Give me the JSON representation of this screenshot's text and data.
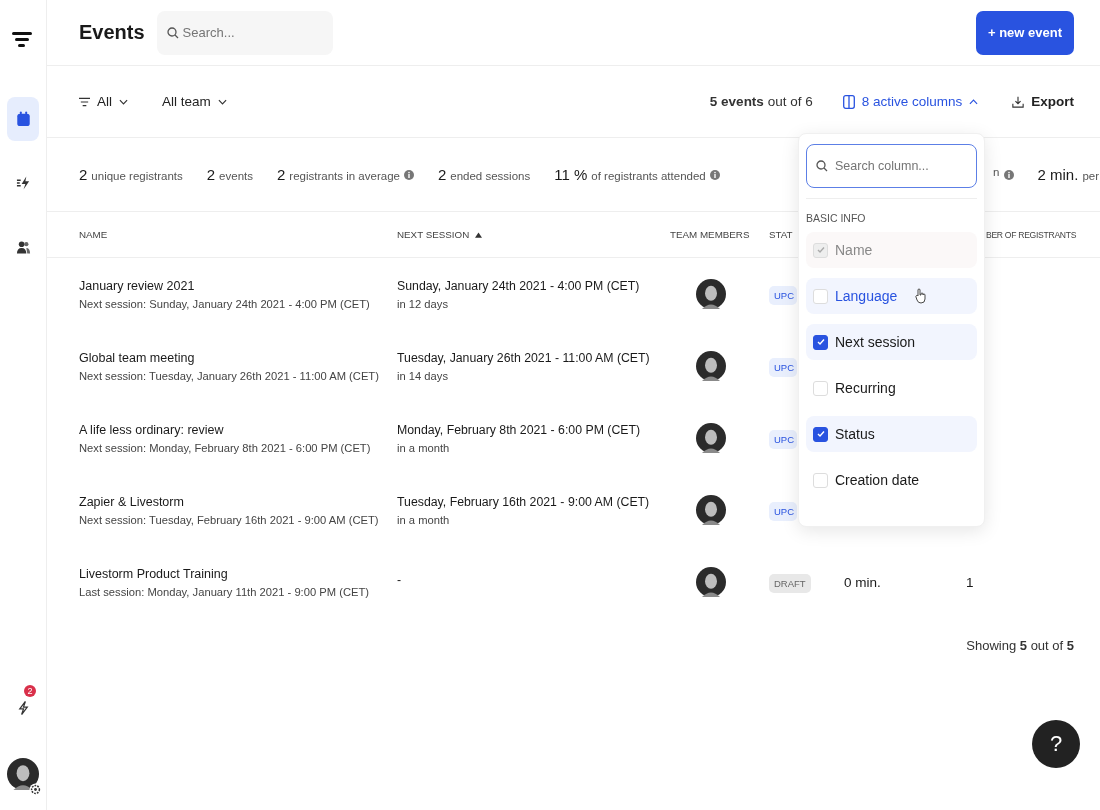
{
  "sidebar": {
    "nav": [
      {
        "selected": true
      },
      {
        "selected": false
      },
      {
        "selected": false
      }
    ],
    "notifications": {
      "badge": "2"
    }
  },
  "header": {
    "title": "Events",
    "search": {
      "placeholder": "Search..."
    },
    "new_button": "+ new event"
  },
  "toolbar": {
    "filters": [
      {
        "label": "All"
      },
      {
        "label": "All team"
      }
    ],
    "count": "**5 events** out of 6",
    "columns_button": "8 active columns",
    "export_button": "Export"
  },
  "stats": [
    {
      "value": "2",
      "label": "unique registrants",
      "info": false
    },
    {
      "value": "2",
      "label": "events",
      "info": false
    },
    {
      "value": "2",
      "label": "registrants in average",
      "info": true
    },
    {
      "value": "2",
      "label": "ended sessions",
      "info": false
    },
    {
      "value": "11 %",
      "label": "of registrants attended",
      "info": true
    }
  ],
  "stats_right": [
    {
      "label": "n",
      "info": true
    },
    {
      "value": "2 min.",
      "label": "per",
      "info": false
    }
  ],
  "table": {
    "columns": [
      {
        "label": "NAME",
        "sorted": false
      },
      {
        "label": "NEXT SESSION",
        "sorted": true
      },
      {
        "label": "TEAM MEMBERS",
        "sorted": false
      },
      {
        "label": "STAT",
        "sorted": false
      },
      {
        "label": "BER OF REGISTRANTS",
        "sorted": false
      }
    ],
    "rows": [
      {
        "name": "January review 2021",
        "subtitle": "Next session: Sunday, January 24th 2021 - 4:00 PM (CET)",
        "next_session": "Sunday, January 24th 2021 - 4:00 PM (CET)",
        "relative": "in 12 days",
        "status": {
          "label": "UPC",
          "kind": "upcoming"
        }
      },
      {
        "name": "Global team meeting",
        "subtitle": "Next session: Tuesday, January 26th 2021 - 11:00 AM (CET)",
        "next_session": "Tuesday, January 26th 2021 - 11:00 AM (CET)",
        "relative": "in 14 days",
        "status": {
          "label": "UPC",
          "kind": "upcoming"
        }
      },
      {
        "name": "A life less ordinary: review",
        "subtitle": "Next session: Monday, February 8th 2021 - 6:00 PM (CET)",
        "next_session": "Monday, February 8th 2021 - 6:00 PM (CET)",
        "relative": "in a month",
        "status": {
          "label": "UPC",
          "kind": "upcoming"
        }
      },
      {
        "name": "Zapier & Livestorm",
        "subtitle": "Next session: Tuesday, February 16th 2021 - 9:00 AM (CET)",
        "next_session": "Tuesday, February 16th 2021 - 9:00 AM (CET)",
        "relative": "in a month",
        "status": {
          "label": "UPC",
          "kind": "upcoming"
        }
      },
      {
        "name": "Livestorm Product Training",
        "subtitle": "Last session: Monday, January 11th 2021 - 9:00 PM (CET)",
        "next_session": "-",
        "status": {
          "label": "DRAFT",
          "kind": "draft"
        },
        "duration": "0 min.",
        "registrants": "1"
      }
    ]
  },
  "footer": "Showing **5** out of **5**",
  "column_menu": {
    "search": {
      "placeholder": "Search column..."
    },
    "section": "BASIC INFO",
    "items": [
      {
        "label": "Name",
        "checked": true,
        "disabled": true,
        "hovered": false
      },
      {
        "label": "Language",
        "checked": false,
        "disabled": false,
        "hovered": true
      },
      {
        "label": "Next session",
        "checked": true,
        "disabled": false,
        "hovered": false
      },
      {
        "label": "Recurring",
        "checked": false,
        "disabled": false,
        "hovered": false
      },
      {
        "label": "Status",
        "checked": true,
        "disabled": false,
        "hovered": false
      },
      {
        "label": "Creation date",
        "checked": false,
        "disabled": false,
        "hovered": false
      }
    ]
  },
  "help_button": "?"
}
